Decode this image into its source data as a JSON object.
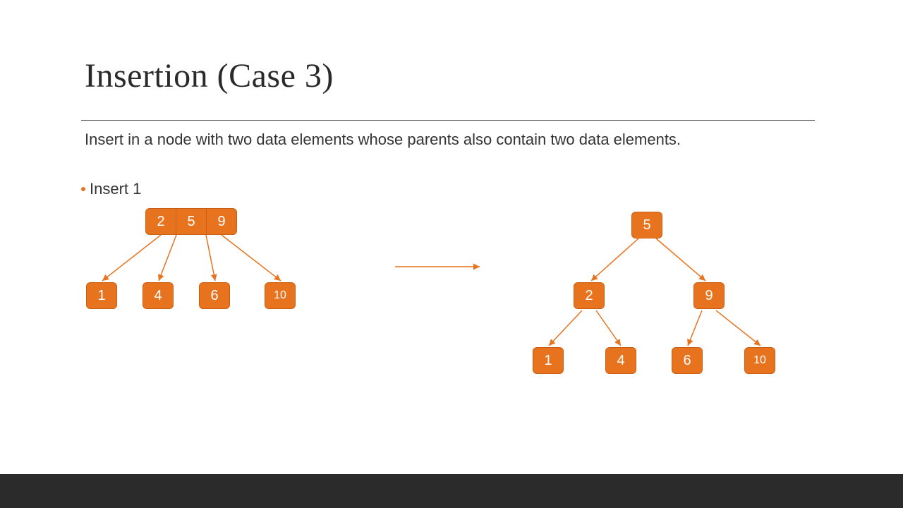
{
  "title": "Insertion (Case 3)",
  "subtitle": "Insert in a node with two data elements whose parents also contain two data elements.",
  "bullet": "Insert 1",
  "colors": {
    "accent": "#e8731f",
    "dark": "#2b2b2b"
  },
  "left_tree": {
    "root": {
      "cells": [
        "2",
        "5",
        "9"
      ]
    },
    "leaves": [
      {
        "value": "1"
      },
      {
        "value": "4"
      },
      {
        "value": "6"
      },
      {
        "value": "10"
      }
    ]
  },
  "right_tree": {
    "root": {
      "value": "5"
    },
    "mid": [
      {
        "value": "2"
      },
      {
        "value": "9"
      }
    ],
    "leaves": [
      {
        "value": "1"
      },
      {
        "value": "4"
      },
      {
        "value": "6"
      },
      {
        "value": "10"
      }
    ]
  }
}
